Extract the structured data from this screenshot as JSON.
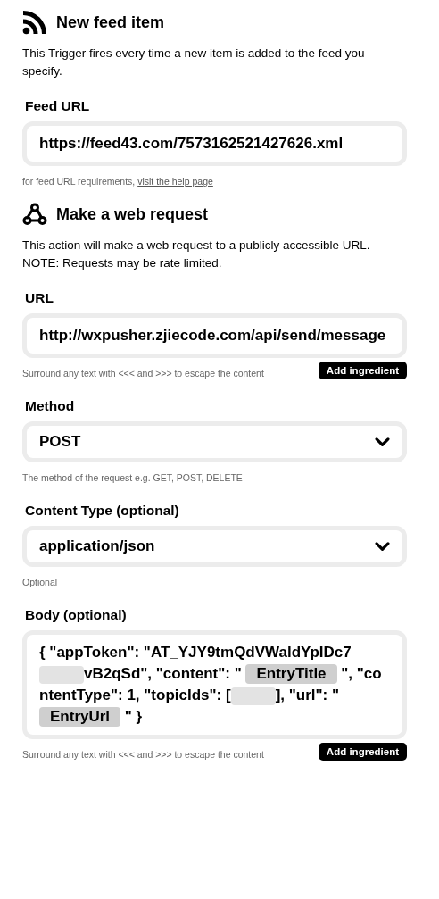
{
  "sections": [
    {
      "kind": "feed",
      "title": "New feed item",
      "description": "This Trigger fires every time a new item is added to the feed you specify.",
      "fields": [
        {
          "kind": "text",
          "label": "Feed URL",
          "value": "https://feed43.com/7573162521427626.xml",
          "help": {
            "text": "for feed URL requirements, ",
            "link": "visit the help page"
          }
        }
      ]
    },
    {
      "kind": "webhook",
      "title": "Make a web request",
      "description": "This action will make a web request to a publicly accessible URL. NOTE: Requests may be rate limited.",
      "fields": [
        {
          "kind": "text",
          "label": "URL",
          "value": "http://wxpusher.zjiecode.com/api/send/message",
          "help": {
            "text": "Surround any text with <<< and >>> to escape the content"
          },
          "button": "Add ingredient"
        },
        {
          "kind": "select",
          "label": "Method",
          "value": "POST",
          "help": {
            "text": "The method of the request e.g. GET, POST, DELETE"
          }
        },
        {
          "kind": "select",
          "label": "Content Type (optional)",
          "value": "application/json",
          "help": {
            "text": "Optional"
          }
        },
        {
          "kind": "body",
          "label": "Body (optional)",
          "segments": [
            {
              "kind": "text",
              "text": "{ \"appToken\": \"AT_YJY9tmQdVWaldYpIDc7"
            },
            {
              "kind": "redacted"
            },
            {
              "kind": "text",
              "text": "vB2qSd\", \"content\": \" "
            },
            {
              "kind": "ingredient",
              "text": "EntryTitle"
            },
            {
              "kind": "text",
              "text": " \", \"contentType\": 1, \"topicIds\": ["
            },
            {
              "kind": "redacted"
            },
            {
              "kind": "text",
              "text": "], \"url\": \" "
            },
            {
              "kind": "ingredient",
              "text": "EntryUrl"
            },
            {
              "kind": "text",
              "text": " \" }"
            }
          ],
          "help": {
            "text": "Surround any text with <<< and >>> to escape the content"
          },
          "button": "Add ingredient"
        }
      ]
    }
  ]
}
